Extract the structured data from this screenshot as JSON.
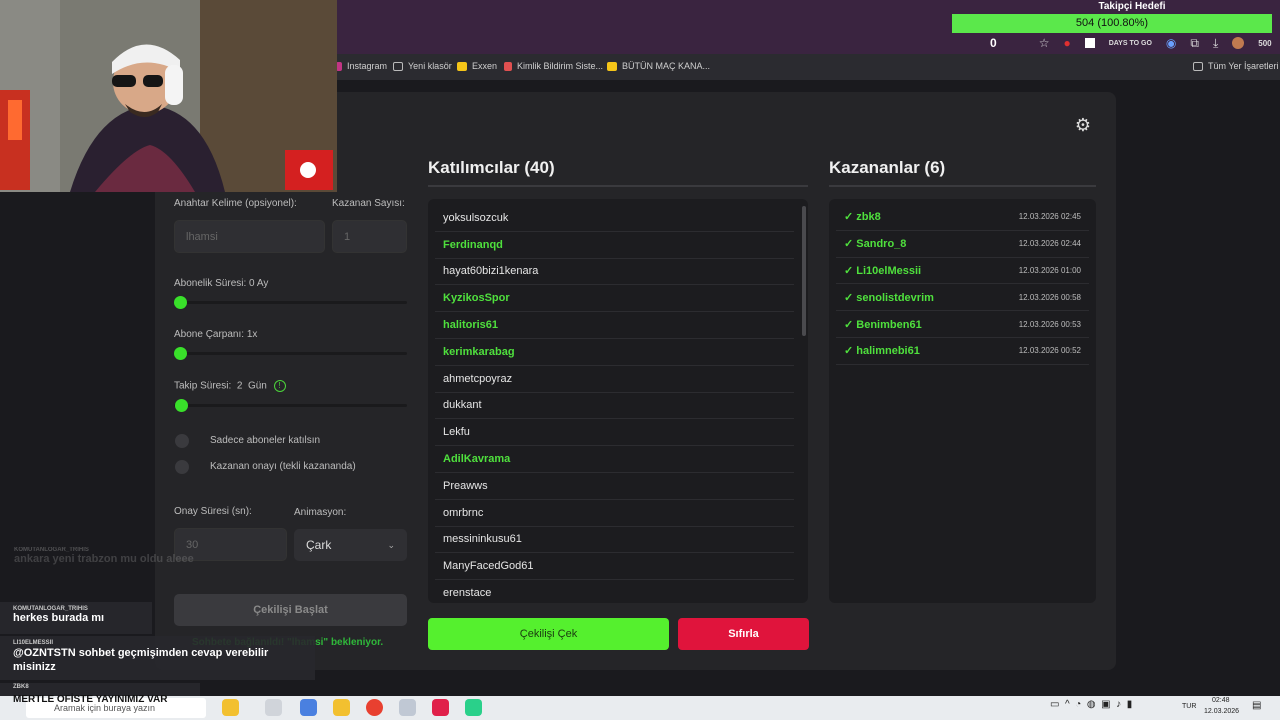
{
  "browser": {
    "follower_count": "0",
    "days_to_go": "DAYS TO GO",
    "badge_count": "500",
    "bookmarks": [
      {
        "label": "Instagram",
        "color": "#c13584"
      },
      {
        "label": "Yeni klasör",
        "color": "#aaaaaa"
      },
      {
        "label": "Exxen",
        "color": "#f5c518"
      },
      {
        "label": "Kimlik Bildirim Siste...",
        "color": "#e05050"
      },
      {
        "label": "BÜTÜN MAÇ KANA...",
        "color": "#f5c518"
      }
    ],
    "all_bookmarks": "Tüm Yer İşaretleri"
  },
  "goal": {
    "title": "Takipçi Hedefi",
    "progress_text": "504 (100.80%)",
    "progress": 1.0
  },
  "settings": {
    "keyword_label": "Anahtar Kelime (opsiyonel):",
    "keyword_value": "lhamsi",
    "winners_label": "Kazanan Sayısı:",
    "winners_value": "1",
    "sub_duration_label": "Abonelik Süresi: 0 Ay",
    "sub_multiplier_label": "Abone Çarpanı: 1x",
    "follow_duration_label": "Takip Süresi:",
    "follow_duration_value": "2",
    "follow_duration_unit": "Gün",
    "subs_only_label": "Sadece aboneler katılsın",
    "winner_confirm_label": "Kazanan onayı (tekli kazananda)",
    "confirm_time_label": "Onay Süresi (sn):",
    "confirm_time_value": "30",
    "animation_label": "Animasyon:",
    "animation_value": "Çark",
    "start_button": "Çekilişi Başlat",
    "connected_text": "Sohbete bağlanıldı! \"lhamsi\" bekleniyor."
  },
  "participants": {
    "title": "Katılımcılar (40)",
    "items": [
      {
        "name": "yoksulsozcuk",
        "sub": false
      },
      {
        "name": "Ferdinanqd",
        "sub": true
      },
      {
        "name": "hayat60bizi1kenara",
        "sub": false
      },
      {
        "name": "KyzikosSpor",
        "sub": true
      },
      {
        "name": "halitoris61",
        "sub": true
      },
      {
        "name": "kerimkarabag",
        "sub": true
      },
      {
        "name": "ahmetcpoyraz",
        "sub": false
      },
      {
        "name": "dukkant",
        "sub": false
      },
      {
        "name": "Lekfu",
        "sub": false
      },
      {
        "name": "AdilKavrama",
        "sub": true
      },
      {
        "name": "Preawws",
        "sub": false
      },
      {
        "name": "omrbrnc",
        "sub": false
      },
      {
        "name": "messininkusu61",
        "sub": false
      },
      {
        "name": "ManyFacedGod61",
        "sub": false
      },
      {
        "name": "erenstace",
        "sub": false
      }
    ]
  },
  "winners": {
    "title": "Kazananlar (6)",
    "items": [
      {
        "name": "✓ zbk8",
        "time": "12.03.2026 02:45"
      },
      {
        "name": "✓ Sandro_8",
        "time": "12.03.2026 02:44"
      },
      {
        "name": "✓ Li10elMessii",
        "time": "12.03.2026 01:00"
      },
      {
        "name": "✓ senolistdevrim",
        "time": "12.03.2026 00:58"
      },
      {
        "name": "✓ Benimben61",
        "time": "12.03.2026 00:53"
      },
      {
        "name": "✓ halimnebi61",
        "time": "12.03.2026 00:52"
      }
    ]
  },
  "actions": {
    "draw_button": "Çekilişi Çek",
    "reset_button": "Sıfırla"
  },
  "chat": [
    {
      "user": "KOMUTANLOGAR_TRIHIS",
      "msg": "ankara yeni trabzon mu oldu aleee",
      "faded": true
    },
    {
      "user": "KOMUTANLOGAR_TRIHIS",
      "msg": "herkes burada mı",
      "faded": false
    },
    {
      "user": "LI10ELMESSII",
      "msg": "@OZNTSTN sohbet geçmişimden cevap verebilir misinizz",
      "faded": false
    },
    {
      "user": "ZBK8",
      "msg": "MERTLE OFİSTE YAYINIMIZ VAR",
      "faded": false
    }
  ],
  "taskbar": {
    "search_placeholder": "Aramak için buraya yazın",
    "lang": "TUR",
    "time": "02:48",
    "date": "12.03.2026"
  }
}
